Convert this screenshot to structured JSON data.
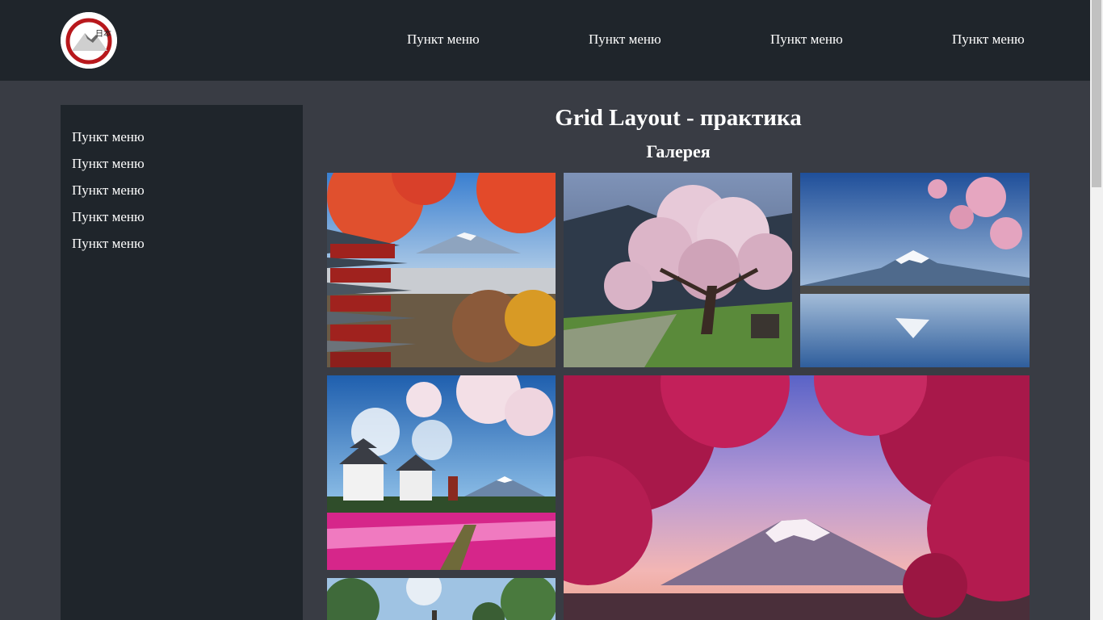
{
  "header": {
    "logo_text": "日本",
    "nav": [
      "Пункт меню",
      "Пункт меню",
      "Пункт меню",
      "Пункт меню"
    ]
  },
  "sidebar": {
    "items": [
      "Пункт меню",
      "Пункт меню",
      "Пункт меню",
      "Пункт меню",
      "Пункт меню"
    ]
  },
  "main": {
    "title": "Grid Layout - практика",
    "gallery_title": "Галерея"
  },
  "gallery": [
    {
      "subject": "pagoda-mount-fuji-autumn"
    },
    {
      "subject": "cherry-blossom-tree"
    },
    {
      "subject": "mount-fuji-lake-reflection"
    },
    {
      "subject": "castle-pink-flower-fields"
    },
    {
      "subject": "mount-fuji-red-maple"
    },
    {
      "subject": "japanese-garden"
    }
  ]
}
